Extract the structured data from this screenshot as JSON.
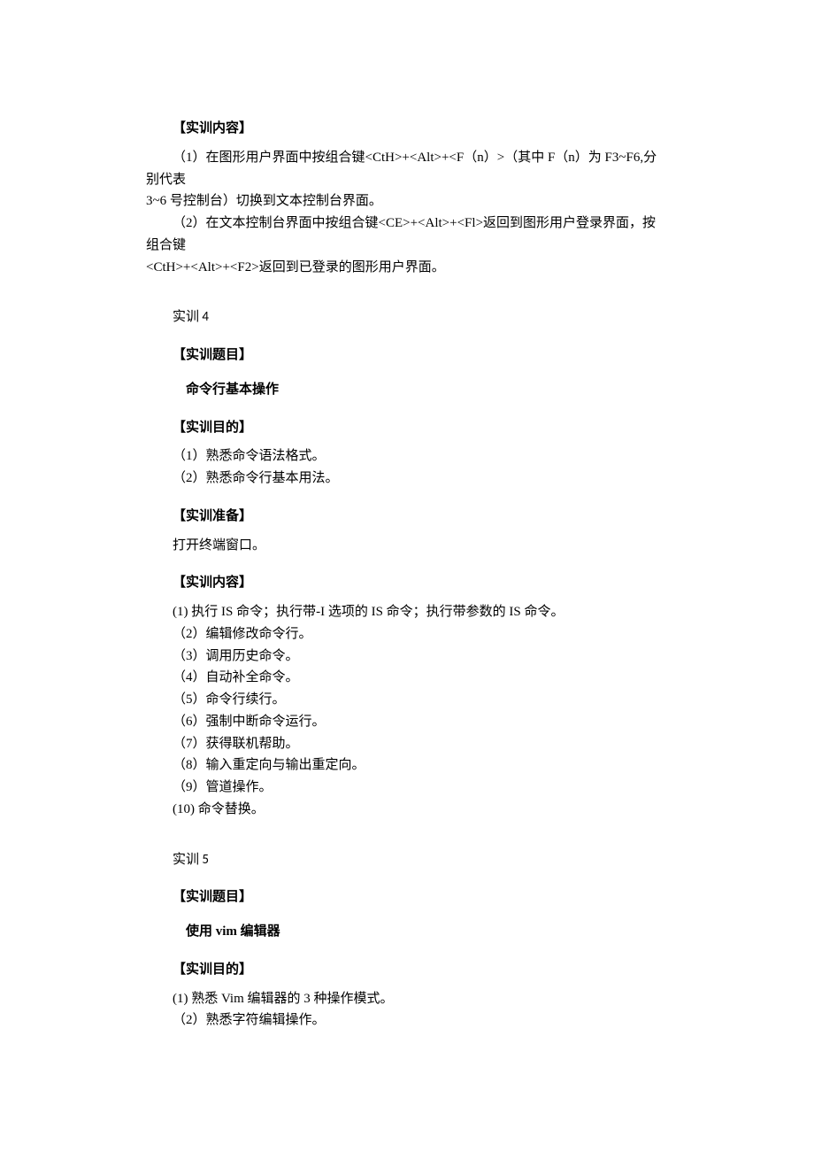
{
  "t3": {
    "content_hdr": "【实训内容】",
    "item1_a": "（1）在图形用户界面中按组合键<CtH>+<Alt>+<F（n）>（其中 F（n）为 F3~F6,分别代表",
    "item1_b": "3~6 号控制台）切换到文本控制台界面。",
    "item2_a": "（2）在文本控制台界面中按组合键<CE>+<Alt>+<Fl>返回到图形用户登录界面，按组合键",
    "item2_b": "<CtH>+<Alt>+<F2>返回到已登录的图形用户界面。"
  },
  "t4": {
    "label": "实训 4",
    "topic_hdr": "【实训题目】",
    "topic_title": "命令行基本操作",
    "goal_hdr": "【实训目的】",
    "goal1": "（1）熟悉命令语法格式。",
    "goal2": "（2）熟悉命令行基本用法。",
    "prep_hdr": "【实训准备】",
    "prep_text": "打开终端窗口。",
    "content_hdr": "【实训内容】",
    "c1": "(1)  执行 IS 命令；执行带-I 选项的 IS 命令；执行带参数的 IS 命令。",
    "c2": "（2）编辑修改命令行。",
    "c3": "（3）调用历史命令。",
    "c4": "（4）自动补全命令。",
    "c5": "（5）命令行续行。",
    "c6": "（6）强制中断命令运行。",
    "c7": "（7）获得联机帮助。",
    "c8": "（8）输入重定向与输出重定向。",
    "c9": "（9）管道操作。",
    "c10": "(10)  命令替换。"
  },
  "t5": {
    "label": "实训 5",
    "topic_hdr": "【实训题目】",
    "topic_title": "使用 vim 编辑器",
    "goal_hdr": "【实训目的】",
    "goal1": "(1)  熟悉 Vim 编辑器的 3 种操作模式。",
    "goal2": "（2）熟悉字符编辑操作。"
  }
}
